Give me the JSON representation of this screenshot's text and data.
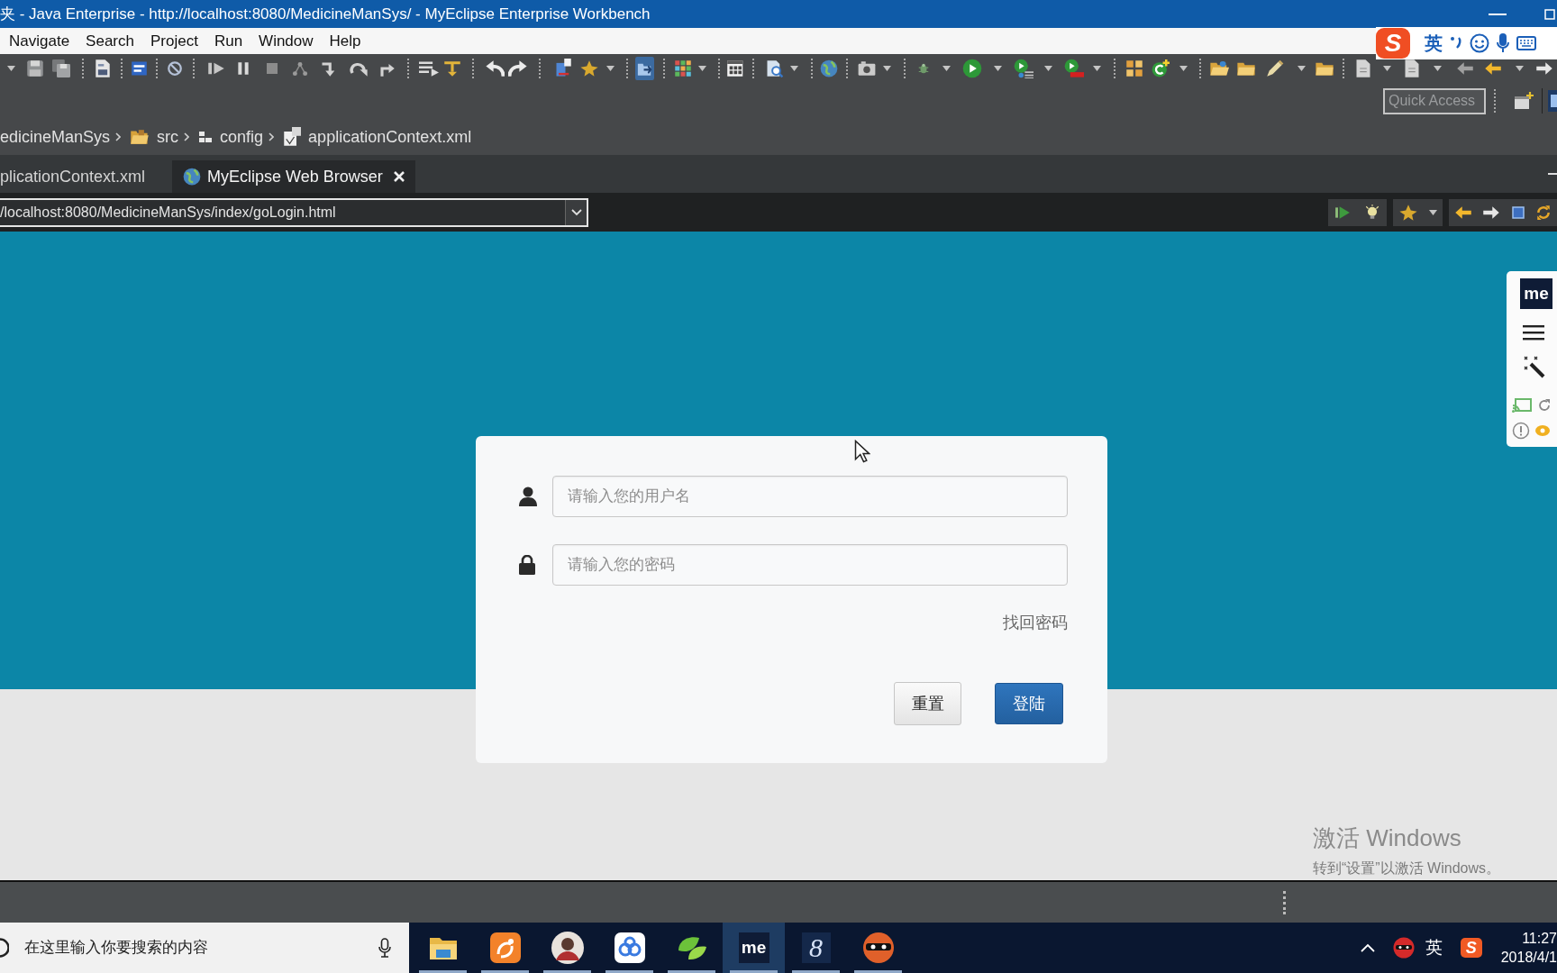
{
  "window": {
    "title": "夹 - Java Enterprise - http://localhost:8080/MedicineManSys/ - MyEclipse Enterprise Workbench"
  },
  "menu_bar": [
    "Navigate",
    "Search",
    "Project",
    "Run",
    "Window",
    "Help"
  ],
  "input_method_bar": {
    "logo": "S",
    "language": "英"
  },
  "quick_access": {
    "placeholder": "Quick Access"
  },
  "breadcrumb": [
    {
      "label": "edicineManSys"
    },
    {
      "label": "src",
      "kind": "source-folder"
    },
    {
      "label": "config",
      "kind": "package"
    },
    {
      "label": "applicationContext.xml",
      "kind": "xml-file"
    }
  ],
  "editor_tabs": [
    {
      "label": "plicationContext.xml",
      "selected": false
    },
    {
      "label": "MyEclipse Web Browser",
      "kind": "browser",
      "selected": true
    }
  ],
  "browser": {
    "url": "/localhost:8080/MedicineManSys/index/goLogin.html",
    "side_panel": {
      "logo": "me"
    }
  },
  "login_form": {
    "username": {
      "placeholder": "请输入您的用户名"
    },
    "password": {
      "placeholder": "请输入您的密码"
    },
    "forgot_link": "找回密码",
    "buttons": [
      {
        "label": "重置",
        "kind": "default"
      },
      {
        "label": "登陆",
        "kind": "primary"
      }
    ]
  },
  "activation_notice": {
    "title": "激活 Windows",
    "text": "转到“设置”以激活 Windows。"
  },
  "taskbar": {
    "search": {
      "placeholder": "在这里输入你要搜索的内容"
    },
    "apps": [
      {
        "kind": "folder",
        "running": true,
        "selected": false
      },
      {
        "kind": "swirl",
        "running": true,
        "selected": false
      },
      {
        "kind": "avatar",
        "running": true,
        "selected": false
      },
      {
        "kind": "cloud",
        "running": true,
        "selected": false
      },
      {
        "kind": "leaf",
        "running": true,
        "selected": false
      },
      {
        "kind": "ide",
        "logo": "me",
        "running": true,
        "selected": true
      },
      {
        "kind": "script",
        "logo": "8",
        "running": true,
        "selected": false
      },
      {
        "kind": "mask",
        "running": true,
        "selected": false
      }
    ],
    "tray": {
      "language": "英",
      "ime_logo": "S",
      "time": "11:27",
      "date": "2018/4/1"
    }
  }
}
